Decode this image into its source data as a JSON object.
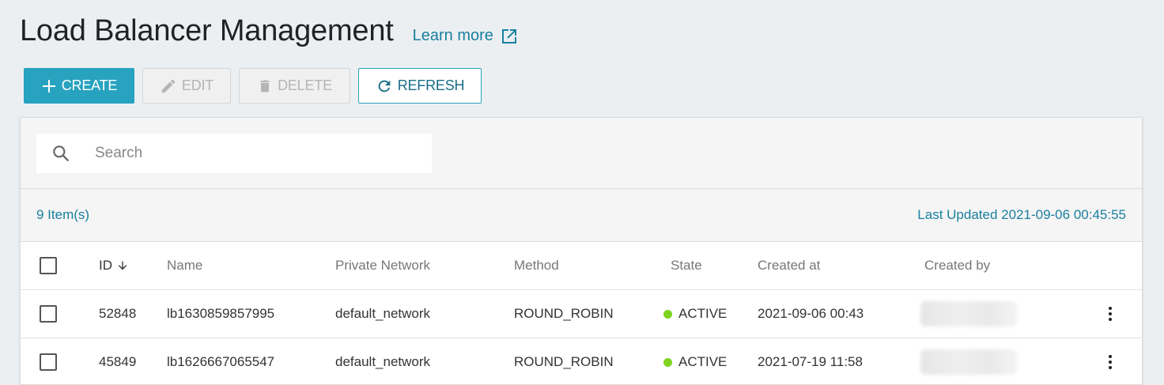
{
  "header": {
    "title": "Load Balancer Management",
    "learn_more": "Learn more"
  },
  "toolbar": {
    "create_label": "CREATE",
    "edit_label": "EDIT",
    "delete_label": "DELETE",
    "refresh_label": "REFRESH"
  },
  "search": {
    "placeholder": "Search",
    "value": ""
  },
  "info": {
    "item_count": "9 Item(s)",
    "last_updated": "Last Updated 2021-09-06 00:45:55"
  },
  "table": {
    "columns": {
      "id": "ID",
      "name": "Name",
      "network": "Private Network",
      "method": "Method",
      "state": "State",
      "created_at": "Created at",
      "created_by": "Created by"
    },
    "rows": [
      {
        "id": "52848",
        "name": "lb1630859857995",
        "network": "default_network",
        "method": "ROUND_ROBIN",
        "state": "ACTIVE",
        "created_at": "2021-09-06 00:43"
      },
      {
        "id": "45849",
        "name": "lb1626667065547",
        "network": "default_network",
        "method": "ROUND_ROBIN",
        "state": "ACTIVE",
        "created_at": "2021-07-19 11:58"
      }
    ]
  },
  "colors": {
    "accent": "#27a3c0",
    "link": "#1a7fa0",
    "active_dot": "#7ed321"
  },
  "icons": {
    "learn_more": "external-link-icon",
    "create": "plus-icon",
    "edit": "pencil-icon",
    "delete": "trash-icon",
    "refresh": "refresh-icon",
    "search": "search-icon",
    "sort": "arrow-down-icon",
    "row_actions": "kebab-menu-icon"
  }
}
